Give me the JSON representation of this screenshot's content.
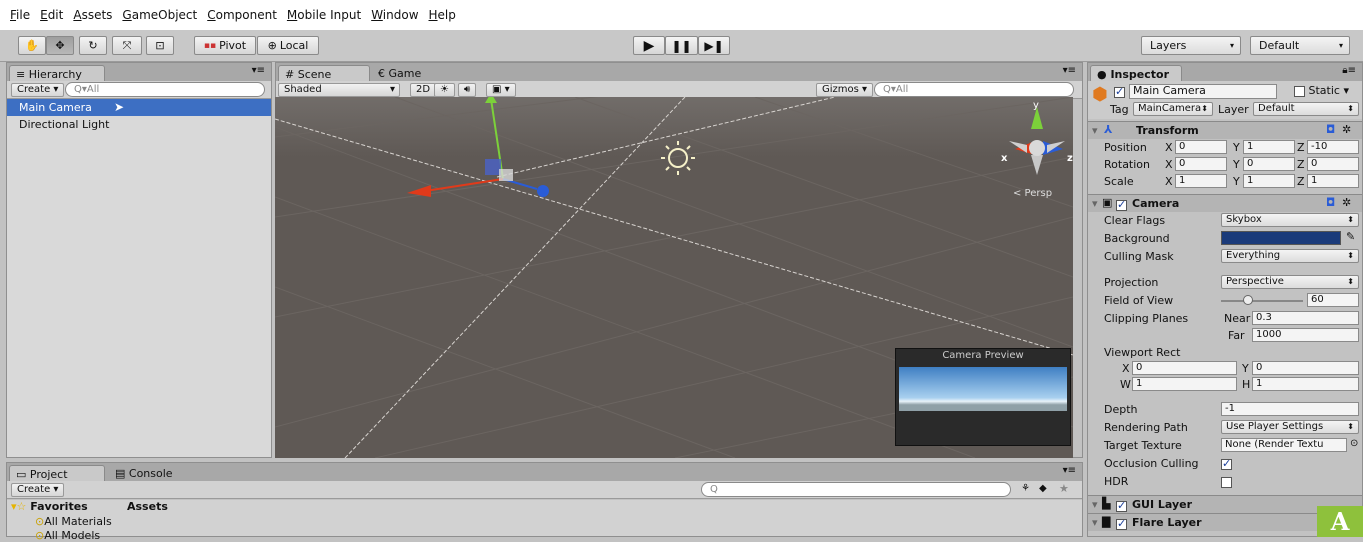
{
  "menu": [
    "File",
    "Edit",
    "Assets",
    "GameObject",
    "Component",
    "Mobile Input",
    "Window",
    "Help"
  ],
  "toolbar": {
    "pivot": "Pivot",
    "local": "Local",
    "layers": "Layers",
    "layout": "Default"
  },
  "hierarchy": {
    "tab": "Hierarchy",
    "create": "Create",
    "search": "Q▾All",
    "items": [
      "Main Camera",
      "Directional Light"
    ]
  },
  "scene": {
    "tab_scene": "Scene",
    "tab_game": "Game",
    "shading": "Shaded",
    "mode2d": "2D",
    "gizmos": "Gizmos",
    "search": "Q▾All",
    "persp": "< Persp",
    "axis_y": "y",
    "axis_x": "x",
    "axis_z": "z",
    "preview_title": "Camera Preview"
  },
  "project": {
    "tab_project": "Project",
    "tab_console": "Console",
    "create": "Create",
    "search": "Q",
    "favorites": "Favorites",
    "assets": "Assets",
    "items": [
      "All Materials",
      "All Models"
    ]
  },
  "inspector": {
    "tab": "Inspector",
    "name": "Main Camera",
    "static": "Static",
    "tag_label": "Tag",
    "tag": "MainCamera",
    "layer_label": "Layer",
    "layer": "Default",
    "transform": {
      "title": "Transform",
      "position_label": "Position",
      "rotation_label": "Rotation",
      "scale_label": "Scale",
      "position": {
        "x": "0",
        "y": "1",
        "z": "-10"
      },
      "rotation": {
        "x": "0",
        "y": "0",
        "z": "0"
      },
      "scale": {
        "x": "1",
        "y": "1",
        "z": "1"
      }
    },
    "camera": {
      "title": "Camera",
      "clear_flags_label": "Clear Flags",
      "clear_flags": "Skybox",
      "background_label": "Background",
      "background_color": "#1a3a7a",
      "culling_mask_label": "Culling Mask",
      "culling_mask": "Everything",
      "projection_label": "Projection",
      "projection": "Perspective",
      "fov_label": "Field of View",
      "fov": "60",
      "fov_slider_fraction": 0.33,
      "clipping_label": "Clipping Planes",
      "near_label": "Near",
      "near": "0.3",
      "far_label": "Far",
      "far": "1000",
      "viewport_label": "Viewport Rect",
      "vp": {
        "x": "0",
        "y": "0",
        "w": "1",
        "h": "1"
      },
      "depth_label": "Depth",
      "depth": "-1",
      "rendering_path_label": "Rendering Path",
      "rendering_path": "Use Player Settings",
      "target_texture_label": "Target Texture",
      "target_texture": "None (Render Textu",
      "occlusion_label": "Occlusion Culling",
      "hdr_label": "HDR"
    },
    "gui_layer": "GUI Layer",
    "flare_layer": "Flare Layer"
  },
  "badge": "A",
  "colors": {
    "selection": "#3d6fc3",
    "badge": "#8ec13c",
    "axis_x": "#e03a1a",
    "axis_y": "#7cd13a",
    "axis_z": "#2a5cd6"
  }
}
